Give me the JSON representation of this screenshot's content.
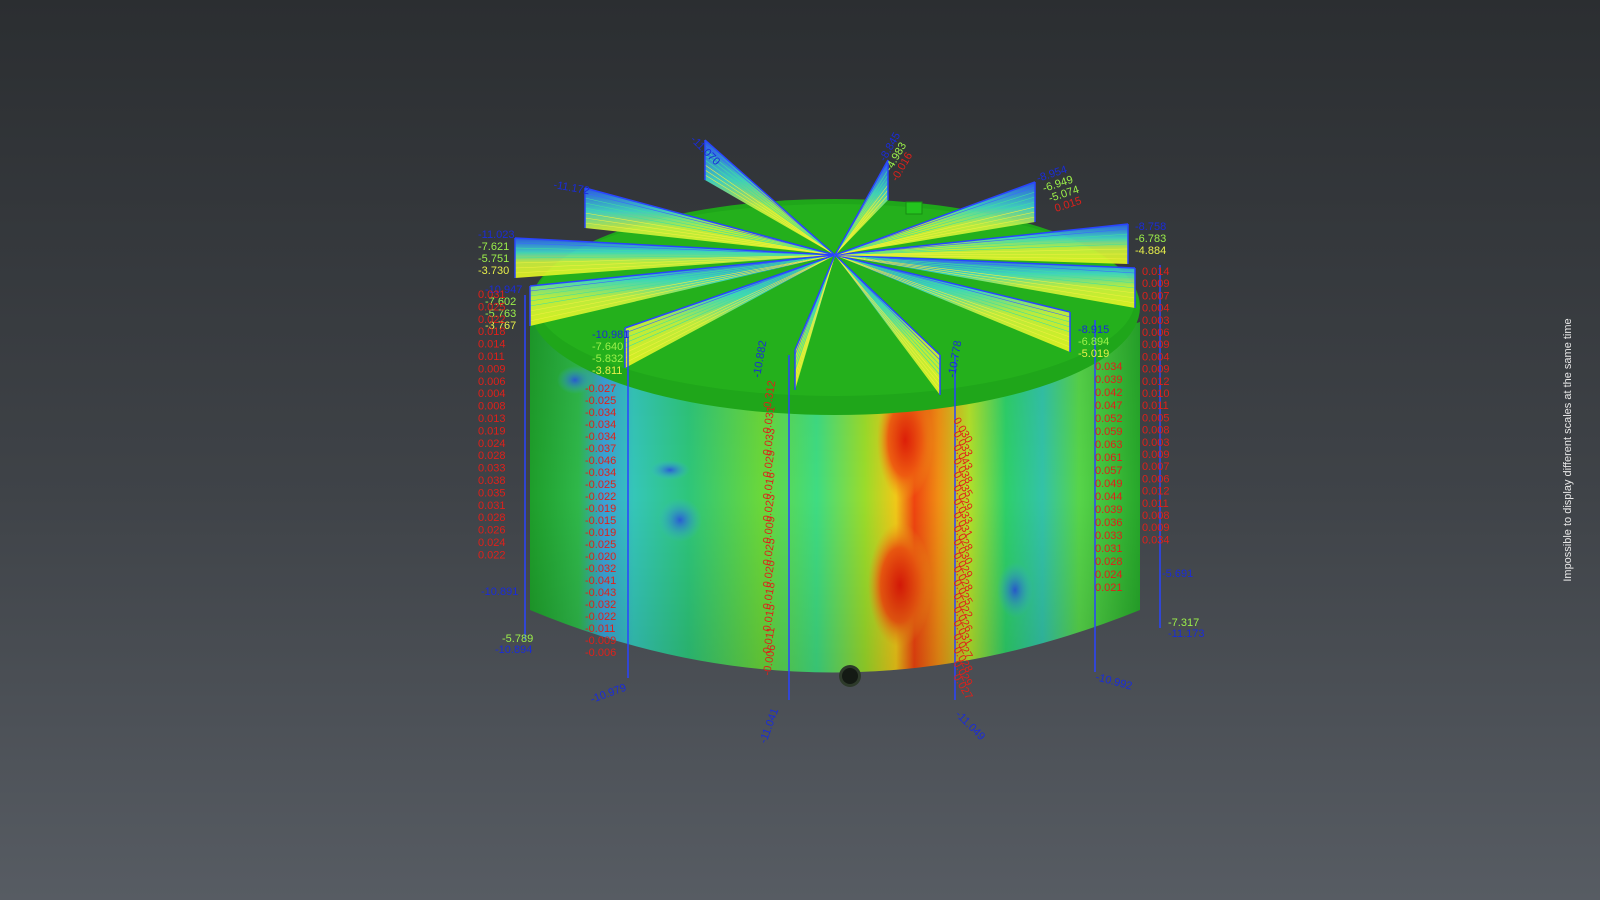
{
  "notice": "Impossible to display different scales at the same time",
  "colors": {
    "background_top": "#2b2e31",
    "background_bottom": "#575c63",
    "surface_green": "#23b21a",
    "deviation_high": "#e8220a",
    "deviation_low": "#2f6fd6",
    "label_red": "#e0201a",
    "label_blue": "#1a2cd8",
    "label_green": "#9cf04a",
    "label_cyan": "#4ad0e8",
    "label_yellow": "#e8f04a"
  },
  "section_labels": {
    "top_fins": [
      {
        "id": "fin-nw-top",
        "values": [
          "-11.070"
        ]
      },
      {
        "id": "fin-n-top",
        "values": [
          "-8.845",
          "-4.983",
          "-0.016"
        ]
      },
      {
        "id": "fin-nw2",
        "values": [
          "-11.172"
        ]
      },
      {
        "id": "fin-ne",
        "values": [
          "-8.954",
          "-6.949",
          "-5.074",
          "0.015"
        ]
      },
      {
        "id": "fin-w",
        "values": [
          "-11.023",
          "-7.621",
          "-5.751",
          "-3.730"
        ]
      },
      {
        "id": "fin-e",
        "values": [
          "-8.758",
          "-6.783",
          "-4.884"
        ]
      },
      {
        "id": "fin-w2",
        "values": [
          "-10.947",
          "-7.602",
          "-5.763",
          "-3.767"
        ]
      },
      {
        "id": "fin-e2",
        "values": [
          "-8.915",
          "-6.894",
          "-5.019"
        ]
      },
      {
        "id": "fin-sw",
        "values": [
          "-10.981",
          "-7.640",
          "-5.832",
          "-3.811"
        ]
      },
      {
        "id": "fin-s",
        "values": [
          "-10.882"
        ]
      },
      {
        "id": "fin-se",
        "values": [
          "-10.778"
        ]
      }
    ],
    "wall_left": [
      "-0.027",
      "-0.025",
      "-0.034",
      "-0.034",
      "-0.034",
      "-0.037",
      "-0.046",
      "-0.034",
      "-0.025",
      "-0.022",
      "-0.019",
      "-0.015",
      "-0.019",
      "-0.025",
      "-0.020",
      "-0.032",
      "-0.041",
      "-0.043",
      "-0.032",
      "-0.022",
      "-0.011",
      "-0.009",
      "-0.006"
    ],
    "wall_center": [
      "-0.312",
      "0.031",
      "0.033",
      "0.029",
      "0.016",
      "0.023",
      "0.009",
      "0.025",
      "0.020",
      "0.018",
      "0.015",
      "0.011",
      "-0.006"
    ],
    "wall_right": [
      "0.030",
      "0.033",
      "0.043",
      "0.038",
      "0.035",
      "0.029",
      "0.033",
      "0.031",
      "0.028",
      "0.030",
      "0.029",
      "0.028",
      "0.025",
      "0.022",
      "0.026",
      "0.031",
      "0.027",
      "0.028",
      "0.029",
      "0.027"
    ],
    "wall_far_right": [
      "0.034",
      "0.039",
      "0.042",
      "0.047",
      "0.052",
      "0.059",
      "0.063",
      "0.061",
      "0.057",
      "0.049",
      "0.044",
      "0.039",
      "0.036",
      "0.033",
      "0.031",
      "0.028",
      "0.024",
      "0.021"
    ],
    "wall_far_left": [
      "0.031",
      "0.025",
      "0.022",
      "0.018",
      "0.014",
      "0.011",
      "0.009",
      "0.006",
      "0.004",
      "0.008",
      "0.013",
      "0.019",
      "0.024",
      "0.028",
      "0.033",
      "0.038",
      "0.035",
      "0.031",
      "0.028",
      "0.026",
      "0.024",
      "0.022"
    ],
    "wall_rim_right": [
      "0.014",
      "0.009",
      "0.007",
      "0.004",
      "0.003",
      "0.006",
      "0.009",
      "0.004",
      "0.009",
      "0.012",
      "0.010",
      "0.011",
      "0.005",
      "0.008",
      "0.003",
      "0.009",
      "0.007",
      "0.006",
      "0.012",
      "0.011",
      "0.008",
      "0.009",
      "0.034"
    ],
    "bottom": {
      "left_outer": "-10.891",
      "left_green": "-5.789",
      "left_bottom": "-10.894",
      "front_left": "-10.979",
      "front_center": "-11.041",
      "front_right": "-11.049",
      "right_bottom": "-10.992",
      "right_green": "-7.317",
      "right_outer": "-11.173",
      "right_side_top": "-5.691"
    }
  }
}
